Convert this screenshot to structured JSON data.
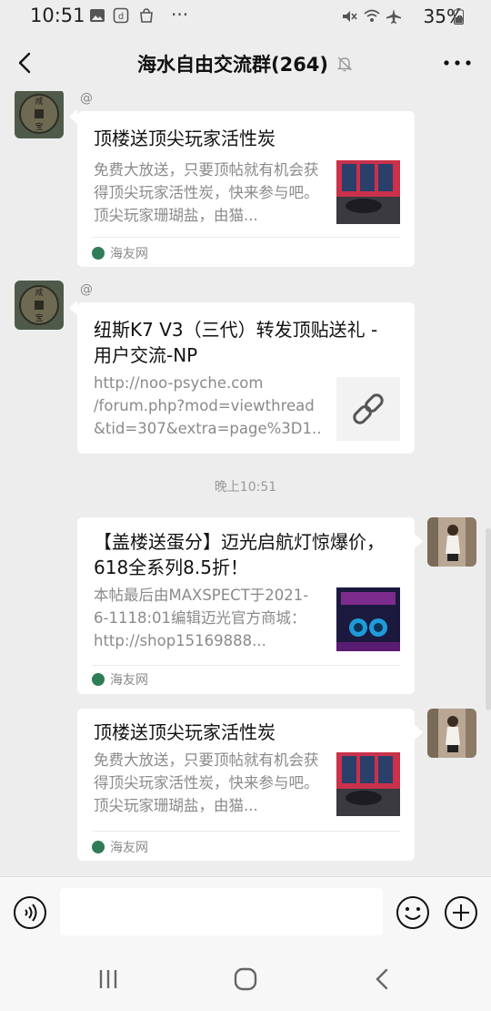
{
  "status_bar": {
    "time": "10:51",
    "dots": "···",
    "battery": "35%"
  },
  "header": {
    "title": "海水自由交流群(264)"
  },
  "messages": [
    {
      "sender_name": "@",
      "title": "顶楼送顶尖玩家活性炭",
      "desc": "免费大放送，只要顶帖就有机会获得顶尖玩家活性炭，快来参与吧。顶尖玩家珊瑚盐，由猫...",
      "source": "海友网"
    },
    {
      "sender_name": "@",
      "title": "纽斯K7 V3（三代）转发顶贴送礼 - 用户交流-NP",
      "desc": "http://noo-psyche.com /forum.php?mod=viewthread &tid=307&extra=page%3D1..."
    },
    {
      "time_label": "晚上10:51"
    },
    {
      "title": "【盖楼送蛋分】迈光启航灯惊爆价，618全系列8.5折！",
      "desc": "本帖最后由MAXSPECT于2021-6-1118:01编辑迈光官方商城：http://shop15169888...",
      "source": "海友网"
    },
    {
      "title": "顶楼送顶尖玩家活性炭",
      "desc": "免费大放送，只要顶帖就有机会获得顶尖玩家活性炭，快来参与吧。顶尖玩家珊瑚盐，由猫...",
      "source": "海友网"
    }
  ],
  "input": {
    "placeholder": ""
  },
  "colors": {
    "background": "#ededed",
    "card": "#ffffff",
    "source_logo": "#2f7d57"
  }
}
